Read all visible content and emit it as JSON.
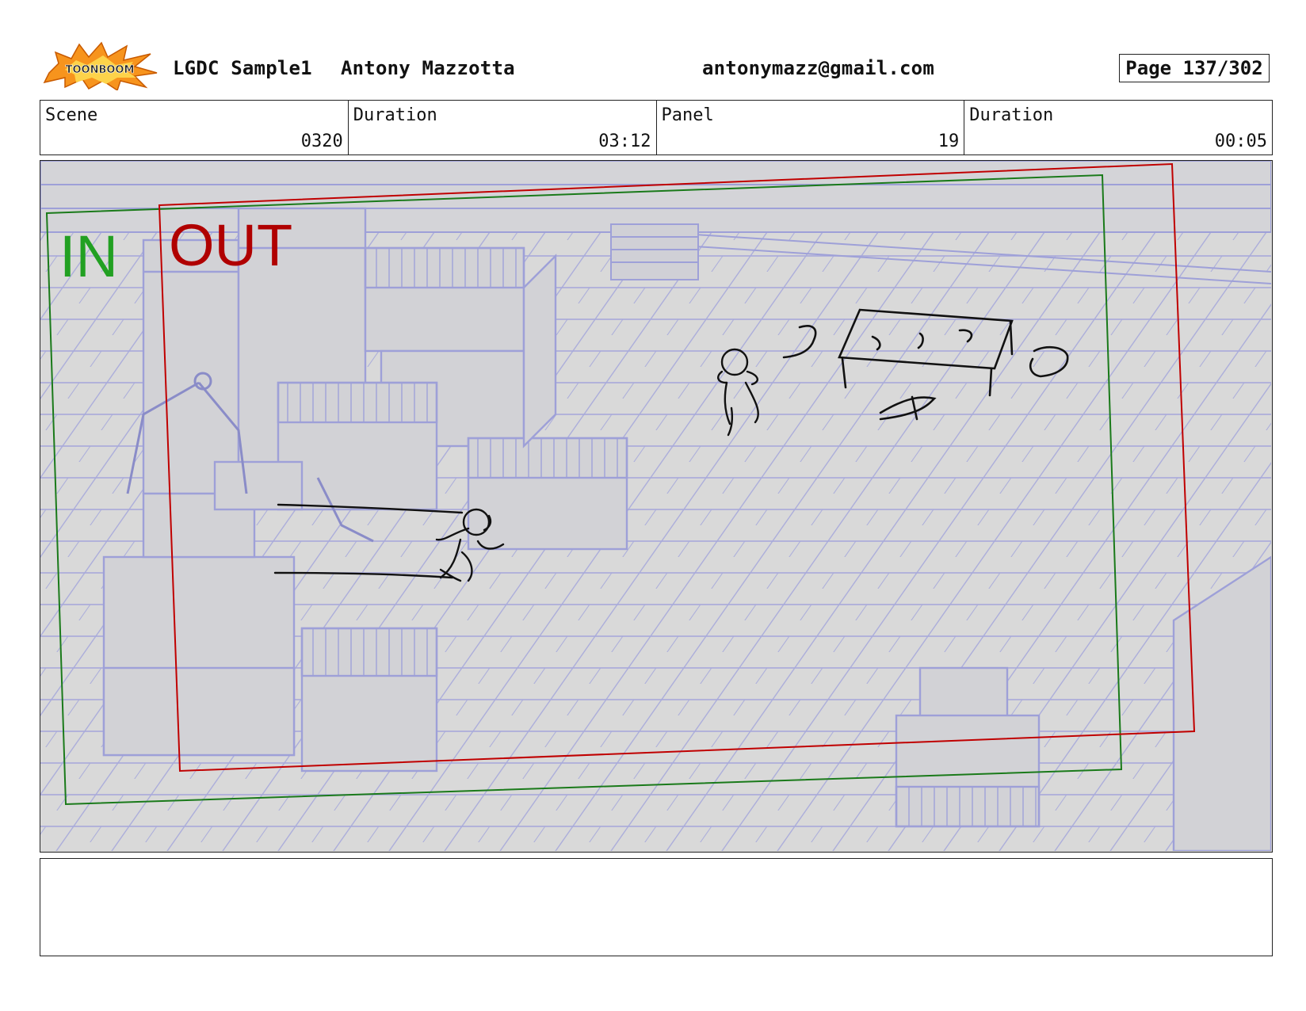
{
  "header": {
    "logo_text": "TOONBOOM",
    "project": "LGDC Sample1",
    "author": "Antony Mazzotta",
    "email": "antonymazz@gmail.com",
    "page": "Page 137/302"
  },
  "info": {
    "scene_label": "Scene",
    "scene_value": "0320",
    "duration_label": "Duration",
    "duration_value": "03:12",
    "panel_label": "Panel",
    "panel_value": "19",
    "panel_duration_label": "Duration",
    "panel_duration_value": "00:05"
  },
  "panel_image": {
    "in_label": "IN",
    "out_label": "OUT",
    "colors": {
      "background": "#d9d9d9",
      "line_art": "#9ea0d8",
      "in_frame": "#1a7a1a",
      "in_text": "#22a022",
      "out_frame": "#c00000",
      "out_text": "#b00000",
      "sketch": "#111111"
    }
  },
  "notes": {
    "text": ""
  }
}
